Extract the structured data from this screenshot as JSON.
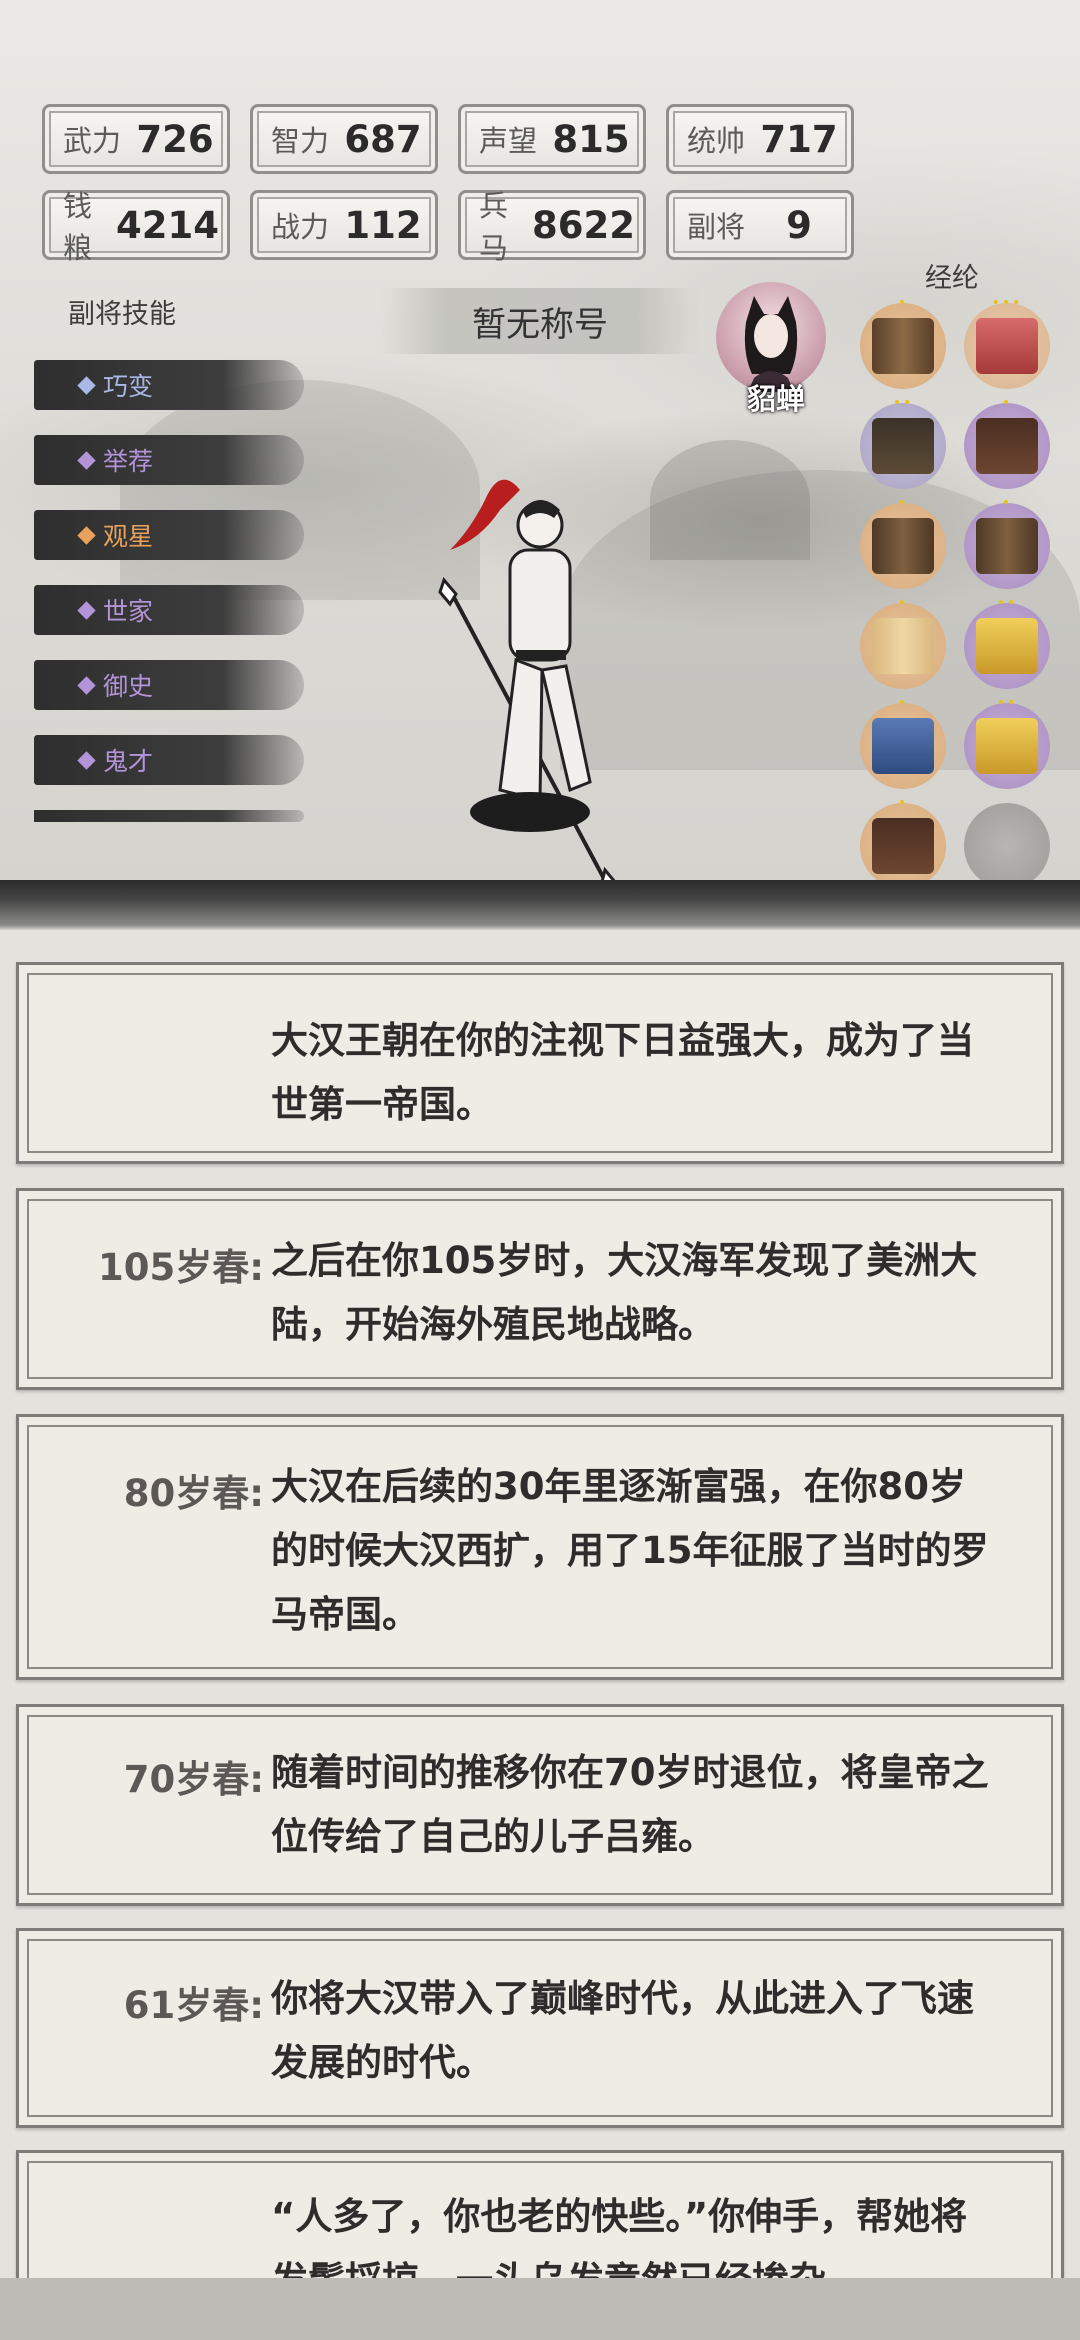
{
  "stats": [
    {
      "label": "武力",
      "value": "726"
    },
    {
      "label": "智力",
      "value": "687"
    },
    {
      "label": "声望",
      "value": "815"
    },
    {
      "label": "统帅",
      "value": "717"
    },
    {
      "label": "钱粮",
      "value": "4214"
    },
    {
      "label": "战力",
      "value": "112"
    },
    {
      "label": "兵马",
      "value": "8622"
    },
    {
      "label": "副将",
      "value": "9"
    }
  ],
  "skills_title": "副将技能",
  "skills": [
    {
      "name": "巧变",
      "color": "#a9b8e6"
    },
    {
      "name": "举荐",
      "color": "#b494d8"
    },
    {
      "name": "观星",
      "color": "#e8a25e"
    },
    {
      "name": "世家",
      "color": "#b494d8"
    },
    {
      "name": "御史",
      "color": "#b494d8"
    },
    {
      "name": "鬼才",
      "color": "#b494d8"
    }
  ],
  "hero_title": "暂无称号",
  "companion_name": "貂蝉",
  "books_title": "经纶",
  "books": [
    {
      "icon": "scroll-icon",
      "stars": "•"
    },
    {
      "icon": "book-box-icon",
      "stars": "•••"
    },
    {
      "icon": "book-stack-icon",
      "stars": "••"
    },
    {
      "icon": "book-stack-icon",
      "stars": "•"
    },
    {
      "icon": "scroll-icon",
      "stars": "•"
    },
    {
      "icon": "scroll-icon",
      "stars": "•"
    },
    {
      "icon": "open-book-icon",
      "stars": "•"
    },
    {
      "icon": "book-box-icon",
      "stars": "••"
    },
    {
      "icon": "book-box-icon",
      "stars": "•"
    },
    {
      "icon": "book-box-icon",
      "stars": "••"
    },
    {
      "icon": "book-stack-icon",
      "stars": "•"
    },
    {
      "icon": "empty-slot-icon",
      "stars": ""
    }
  ],
  "events": [
    {
      "age": "",
      "text": "大汉王朝在你的注视下日益强大，成为了当世第一帝国。"
    },
    {
      "age": "105岁春:",
      "text": "之后在你105岁时，大汉海军发现了美洲大陆，开始海外殖民地战略。"
    },
    {
      "age": "80岁春:",
      "text": "大汉在后续的30年里逐渐富强，在你80岁的时候大汉西扩，用了15年征服了当时的罗马帝国。"
    },
    {
      "age": "70岁春:",
      "text": "随着时间的推移你在70岁时退位，将皇帝之位传给了自己的儿子吕雍。"
    },
    {
      "age": "61岁春:",
      "text": "你将大汉带入了巅峰时代，从此进入了飞速发展的时代。"
    },
    {
      "age": "",
      "text": "“人多了，你也老的快些。”你伸手，帮她将发鬓捋掠，一头乌发竟然已经掺杂"
    }
  ]
}
